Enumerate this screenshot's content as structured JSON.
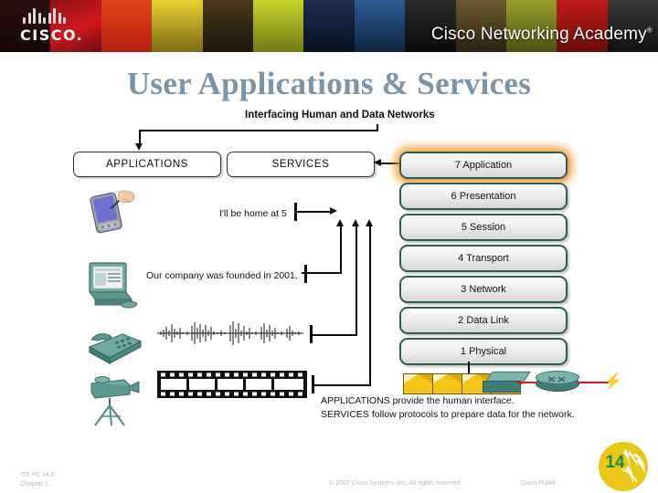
{
  "header": {
    "logo_text": "CISCO",
    "logo_dot": ".",
    "program_title": "Cisco Networking Academy",
    "trademark": "®",
    "strip_colors": [
      "#2a0f10",
      "#7d1518",
      "#c0121a",
      "#e03a16",
      "#d7c41c",
      "#3b2a12",
      "#0d1624",
      "#1d3f6e",
      "#101010",
      "#5a4a2a",
      "#8a8f2a",
      "#b01a18",
      "#2a2a2a"
    ]
  },
  "title": "User Applications & Services",
  "diagram": {
    "headline": "Interfacing Human and Data Networks",
    "applications_box": "APPLICATIONS",
    "services_box": "SERVICES",
    "message_text": "I'll be home at 5",
    "document_text": "Our company was founded in 2001.",
    "caption_line1": "APPLICATIONS provide the human interface.",
    "caption_line2": "SERVICES follow protocols to prepare data for the network.",
    "devices": [
      {
        "name": "pda-stylus-icon",
        "label": "PDA with stylus"
      },
      {
        "name": "desktop-computer-icon",
        "label": "Desktop computer"
      },
      {
        "name": "telephone-icon",
        "label": "Telephone"
      },
      {
        "name": "video-camera-icon",
        "label": "Video camera on tripod"
      }
    ],
    "media": [
      {
        "name": "audio-waveform",
        "label": "Audio waveform"
      },
      {
        "name": "film-strip",
        "label": "Film strip"
      }
    ],
    "network": {
      "envelope_count": 4,
      "switch_label": "Switch",
      "router_label": "Router"
    },
    "osi_layers": [
      {
        "label": "7 Application",
        "highlighted": true
      },
      {
        "label": "6 Presentation",
        "highlighted": false
      },
      {
        "label": "5 Session",
        "highlighted": false
      },
      {
        "label": "4 Transport",
        "highlighted": false
      },
      {
        "label": "3 Network",
        "highlighted": false
      },
      {
        "label": "2 Data Link",
        "highlighted": false
      },
      {
        "label": "1 Physical",
        "highlighted": false
      }
    ],
    "highlight_color": "#f7941d",
    "layer_border_color": "#2f5c55"
  },
  "footer": {
    "course": "ITE PC v4.0",
    "chapter": "Chapter 1",
    "copyright": "© 2007 Cisco Systems, Inc. All rights reserved.",
    "classification": "Cisco Public",
    "page_number": "14"
  }
}
